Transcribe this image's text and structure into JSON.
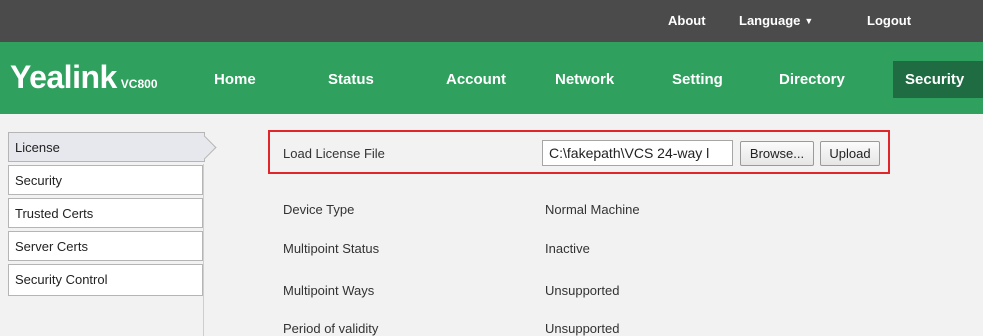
{
  "topbar": {
    "about": "About",
    "language": "Language",
    "logout": "Logout"
  },
  "brand": {
    "name": "Yealink",
    "model": "VC800"
  },
  "nav": {
    "items": [
      {
        "label": "Home"
      },
      {
        "label": "Status"
      },
      {
        "label": "Account"
      },
      {
        "label": "Network"
      },
      {
        "label": "Setting"
      },
      {
        "label": "Directory"
      },
      {
        "label": "Security",
        "active": true
      }
    ]
  },
  "sidebar": {
    "items": [
      {
        "label": "License",
        "active": true
      },
      {
        "label": "Security"
      },
      {
        "label": "Trusted Certs"
      },
      {
        "label": "Server Certs"
      },
      {
        "label": "Security Control"
      }
    ]
  },
  "license": {
    "load_label": "Load License File",
    "file_value": "C:\\fakepath\\VCS 24-way l",
    "browse_label": "Browse...",
    "upload_label": "Upload",
    "fields": [
      {
        "label": "Device Type",
        "value": "Normal Machine"
      },
      {
        "label": "Multipoint Status",
        "value": "Inactive"
      },
      {
        "label": "Multipoint Ways",
        "value": "Unsupported"
      },
      {
        "label": "Period of validity",
        "value": "Unsupported"
      }
    ]
  },
  "colors": {
    "topbar": "#4b4b4b",
    "nav_green": "#30a05e",
    "nav_active": "#1f6b42",
    "highlight_border": "#e0262b",
    "content_bg": "#f2f2f2"
  }
}
